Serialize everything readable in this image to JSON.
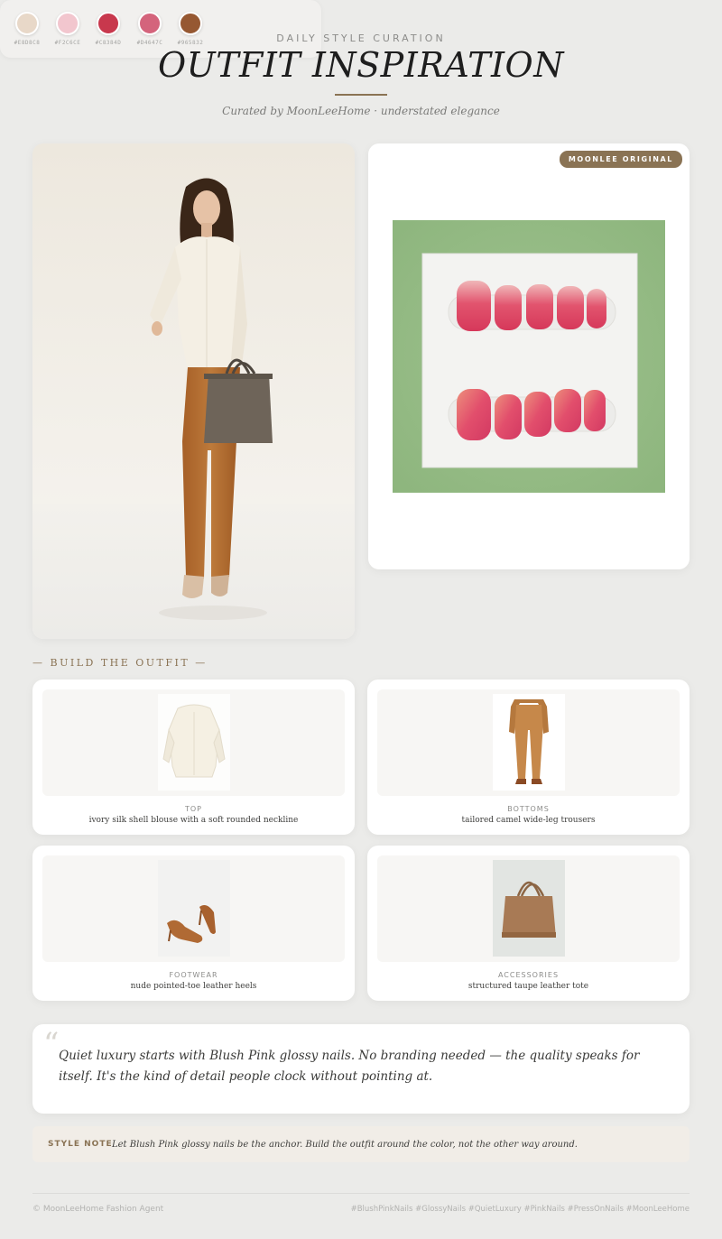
{
  "header": {
    "eyebrow": "DAILY STYLE CURATION",
    "title": "OUTFIT INSPIRATION",
    "subtitle": "Curated by MoonLeeHome · understated elegance"
  },
  "product": {
    "badge": "MOONLEE ORIGINAL"
  },
  "palette": [
    {
      "hex": "#E8D8C8",
      "label": "#E8D8C8"
    },
    {
      "hex": "#F2C6CE",
      "label": "#F2C6CE"
    },
    {
      "hex": "#C8384D",
      "label": "#C8384D"
    },
    {
      "hex": "#D4647C",
      "label": "#D4647C"
    },
    {
      "hex": "#965832",
      "label": "#965832"
    }
  ],
  "build": {
    "heading": "— BUILD THE OUTFIT —",
    "items": [
      {
        "category": "TOP",
        "description": "ivory silk shell blouse with a soft rounded neckline"
      },
      {
        "category": "BOTTOMS",
        "description": "tailored camel wide-leg trousers"
      },
      {
        "category": "FOOTWEAR",
        "description": "nude pointed-toe leather heels"
      },
      {
        "category": "ACCESSORIES",
        "description": "structured taupe leather tote"
      }
    ]
  },
  "quote": {
    "mark": "“",
    "text": "Quiet luxury starts with Blush Pink glossy nails. No branding needed — the quality speaks for itself. It's the kind of detail people clock without pointing at."
  },
  "note": {
    "label": "STYLE NOTE",
    "text": "Let Blush Pink glossy nails be the anchor. Build the outfit around the color, not the other way around."
  },
  "footer": {
    "left": "© MoonLeeHome Fashion Agent",
    "right": "#BlushPinkNails #GlossyNails #QuietLuxury #PinkNails #PressOnNails #MoonLeeHome"
  }
}
